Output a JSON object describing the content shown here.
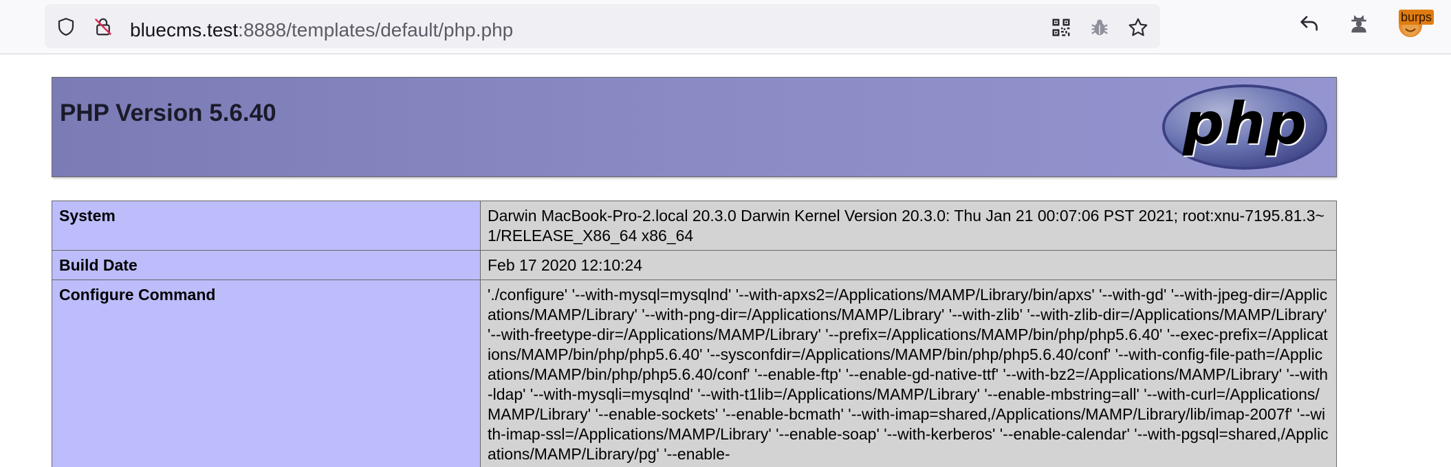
{
  "browser": {
    "url_host": "bluecms.test",
    "url_rest": ":8888/templates/default/php.php",
    "burp_badge": "burps",
    "icons": {
      "tracking_protection": "shield-icon",
      "insecure_connection": "lock-slash-icon",
      "qr_code": "qr-code-icon",
      "bug_extension": "bug-icon",
      "bookmark": "star-icon",
      "back": "reply-arrow-icon",
      "spy_extension": "agent-icon",
      "burp_extension": "burp-icon"
    }
  },
  "page": {
    "title": "PHP Version 5.6.40",
    "logo_text": "php",
    "rows": [
      {
        "key": "System",
        "value": "Darwin MacBook-Pro-2.local 20.3.0 Darwin Kernel Version 20.3.0: Thu Jan 21 00:07:06 PST 2021; root:xnu-7195.81.3~1/RELEASE_X86_64 x86_64"
      },
      {
        "key": "Build Date",
        "value": "Feb 17 2020 12:10:24"
      },
      {
        "key": "Configure Command",
        "value": "'./configure' '--with-mysql=mysqlnd' '--with-apxs2=/Applications/MAMP/Library/bin/apxs' '--with-gd' '--with-jpeg-dir=/Applications/MAMP/Library' '--with-png-dir=/Applications/MAMP/Library' '--with-zlib' '--with-zlib-dir=/Applications/MAMP/Library' '--with-freetype-dir=/Applications/MAMP/Library' '--prefix=/Applications/MAMP/bin/php/php5.6.40' '--exec-prefix=/Applications/MAMP/bin/php/php5.6.40' '--sysconfdir=/Applications/MAMP/bin/php/php5.6.40/conf' '--with-config-file-path=/Applications/MAMP/bin/php/php5.6.40/conf' '--enable-ftp' '--enable-gd-native-ttf' '--with-bz2=/Applications/MAMP/Library' '--with-ldap' '--with-mysqli=mysqlnd' '--with-t1lib=/Applications/MAMP/Library' '--enable-mbstring=all' '--with-curl=/Applications/MAMP/Library' '--enable-sockets' '--enable-bcmath' '--with-imap=shared,/Applications/MAMP/Library/lib/imap-2007f' '--with-imap-ssl=/Applications/MAMP/Library' '--enable-soap' '--with-kerberos' '--enable-calendar' '--with-pgsql=shared,/Applications/MAMP/Library/pg' '--enable-"
      }
    ]
  },
  "colors": {
    "header_bg": "#9999cc",
    "key_cell_bg": "#ccccff",
    "value_cell_bg": "#d3d3d3",
    "toolbar_bg": "#f9f9fb",
    "urlbar_bg": "#f0f0f4"
  }
}
